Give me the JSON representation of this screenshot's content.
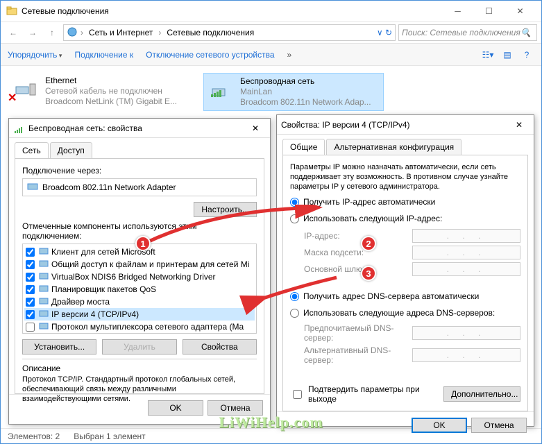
{
  "window": {
    "title": "Сетевые подключения",
    "breadcrumb": [
      "Сеть и Интернет",
      "Сетевые подключения"
    ],
    "search_placeholder": "Поиск: Сетевые подключения"
  },
  "toolbar": {
    "organize": "Упорядочить",
    "connect": "Подключение к",
    "disable": "Отключение сетевого устройства"
  },
  "adapters": [
    {
      "name": "Ethernet",
      "status": "Сетевой кабель не подключен",
      "detail": "Broadcom NetLink (TM) Gigabit E...",
      "disabled": true
    },
    {
      "name": "Беспроводная сеть",
      "status": "MainLan",
      "detail": "Broadcom 802.11n Network Adap...",
      "disabled": false
    }
  ],
  "statusbar": {
    "count": "Элементов: 2",
    "selected": "Выбран 1 элемент"
  },
  "nic_dialog": {
    "title": "Беспроводная сеть: свойства",
    "tabs": [
      "Сеть",
      "Доступ"
    ],
    "connect_using_label": "Подключение через:",
    "adapter": "Broadcom 802.11n Network Adapter",
    "configure_btn": "Настроить...",
    "components_label": "Отмеченные компоненты используются этим подключением:",
    "components": [
      {
        "checked": true,
        "label": "Клиент для сетей Microsoft"
      },
      {
        "checked": true,
        "label": "Общий доступ к файлам и принтерам для сетей Mi"
      },
      {
        "checked": true,
        "label": "VirtualBox NDIS6 Bridged Networking Driver"
      },
      {
        "checked": true,
        "label": "Планировщик пакетов QoS"
      },
      {
        "checked": true,
        "label": "Драйвер моста"
      },
      {
        "checked": true,
        "label": "IP версии 4 (TCP/IPv4)",
        "selected": true
      },
      {
        "checked": false,
        "label": "Протокол мультиплексора сетевого адаптера (Ma"
      }
    ],
    "install_btn": "Установить...",
    "uninstall_btn": "Удалить",
    "properties_btn": "Свойства",
    "description_title": "Описание",
    "description": "Протокол TCP/IP. Стандартный протокол глобальных сетей, обеспечивающий связь между различными взаимодействующими сетями.",
    "ok": "OK",
    "cancel": "Отмена"
  },
  "ipv4_dialog": {
    "title": "Свойства: IP версии 4 (TCP/IPv4)",
    "tabs": [
      "Общие",
      "Альтернативная конфигурация"
    ],
    "intro": "Параметры IP можно назначать автоматически, если сеть поддерживает эту возможность. В противном случае узнайте параметры IP у сетевого администратора.",
    "ip_auto": "Получить IP-адрес автоматически",
    "ip_manual": "Использовать следующий IP-адрес:",
    "ip_label": "IP-адрес:",
    "mask_label": "Маска подсети:",
    "gateway_label": "Основной шлюз:",
    "dns_auto": "Получить адрес DNS-сервера автоматически",
    "dns_manual": "Использовать следующие адреса DNS-серверов:",
    "dns_pref": "Предпочитаемый DNS-сервер:",
    "dns_alt": "Альтернативный DNS-сервер:",
    "confirm_exit": "Подтвердить параметры при выходе",
    "advanced": "Дополнительно...",
    "ok": "OK",
    "cancel": "Отмена"
  },
  "watermark": "LiWiHelp.com"
}
